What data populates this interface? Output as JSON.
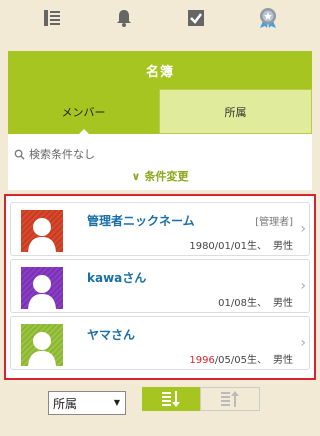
{
  "nav": {
    "icons": [
      "list-icon",
      "bell-icon",
      "checkbox-icon",
      "badge-icon"
    ]
  },
  "title": "名簿",
  "tabs": [
    {
      "label": "メンバー",
      "active": true
    },
    {
      "label": "所属",
      "active": false
    }
  ],
  "search": {
    "condition": "検索条件なし",
    "change_button": "条件変更"
  },
  "members": [
    {
      "name": "管理者ニックネーム",
      "tag": "[管理者]",
      "year": "1980/",
      "rest": "01/01生、",
      "gender": "男性",
      "avatar_color": "#d9492e",
      "year_color": "#444444"
    },
    {
      "name": "kawaさん",
      "tag": "",
      "year": "",
      "rest": "01/08生、",
      "gender": "男性",
      "avatar_color": "#8a3fc5",
      "year_color": "#444444"
    },
    {
      "name": "ヤマさん",
      "tag": "",
      "year": "1996",
      "rest": "/05/05生、",
      "gender": "男性",
      "avatar_color": "#9cc641",
      "year_color": "#d6262d"
    }
  ],
  "footer": {
    "sort_select": "所属",
    "sort_desc_icon": "sort-desc-icon",
    "sort_asc_icon": "sort-asc-icon"
  },
  "colors": {
    "accent": "#a7c520",
    "highlight_border": "#d6262d",
    "background": "#f3ead5"
  }
}
